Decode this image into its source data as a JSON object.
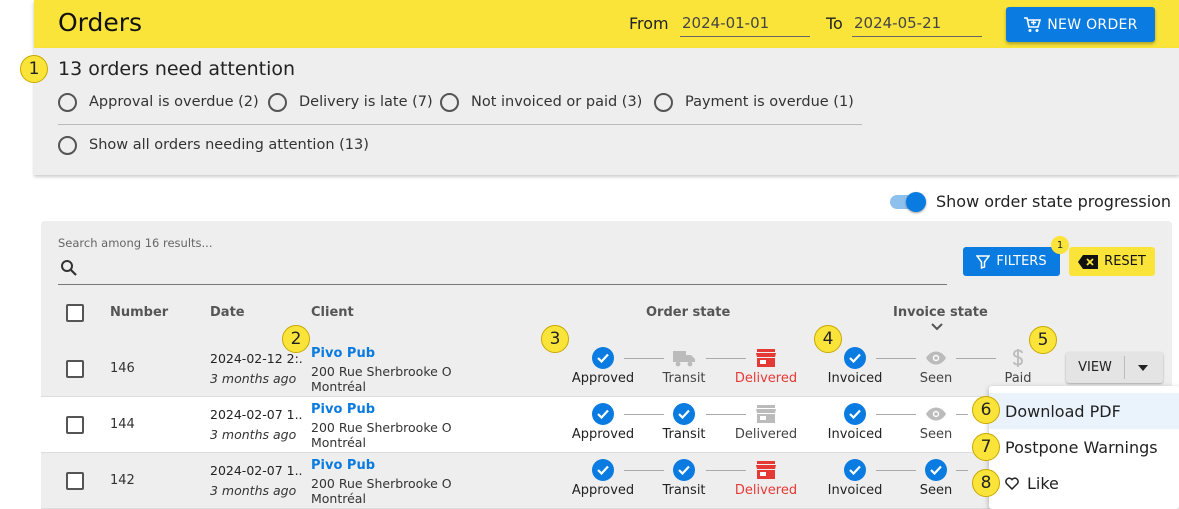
{
  "header": {
    "title": "Orders",
    "from_label": "From",
    "from_value": "2024-01-01",
    "to_label": "To",
    "to_value": "2024-05-21",
    "new_order_label": "NEW ORDER"
  },
  "attention": {
    "title": "13 orders need attention",
    "options": [
      "Approval is overdue (2)",
      "Delivery is late (7)",
      "Not invoiced or paid (3)",
      "Payment is overdue (1)"
    ],
    "show_all": "Show all orders needing attention (13)"
  },
  "toggle": {
    "label": "Show order state progression",
    "on": true
  },
  "search": {
    "placeholder": "Search among 16 results..."
  },
  "filters": {
    "filters_label": "FILTERS",
    "reset_label": "RESET",
    "active_count": "1"
  },
  "table": {
    "columns": {
      "number": "Number",
      "date": "Date",
      "client": "Client",
      "order_state": "Order state",
      "invoice_state": "Invoice state"
    },
    "step_labels": {
      "approved": "Approved",
      "transit": "Transit",
      "delivered": "Delivered",
      "invoiced": "Invoiced",
      "seen": "Seen",
      "paid": "Paid"
    },
    "rows": [
      {
        "number": "146",
        "date": "2024-02-12 2:...",
        "ago": "3 months ago",
        "client": "Pivo Pub",
        "address1": "200 Rue Sherbrooke O",
        "address2": "Montréal"
      },
      {
        "number": "144",
        "date": "2024-02-07 1...",
        "ago": "3 months ago",
        "client": "Pivo Pub",
        "address1": "200 Rue Sherbrooke O",
        "address2": "Montréal"
      },
      {
        "number": "142",
        "date": "2024-02-07 1...",
        "ago": "3 months ago",
        "client": "Pivo Pub",
        "address1": "200 Rue Sherbrooke O",
        "address2": "Montréal"
      }
    ],
    "view_label": "VIEW"
  },
  "menu": {
    "items": [
      "Download PDF",
      "Postpone Warnings",
      "Like"
    ]
  },
  "callouts": [
    "1",
    "2",
    "3",
    "4",
    "5",
    "6",
    "7",
    "8"
  ],
  "colors": {
    "accent": "#0a7be0",
    "brand_yellow": "#fae43a",
    "alert_red": "#e53935"
  }
}
